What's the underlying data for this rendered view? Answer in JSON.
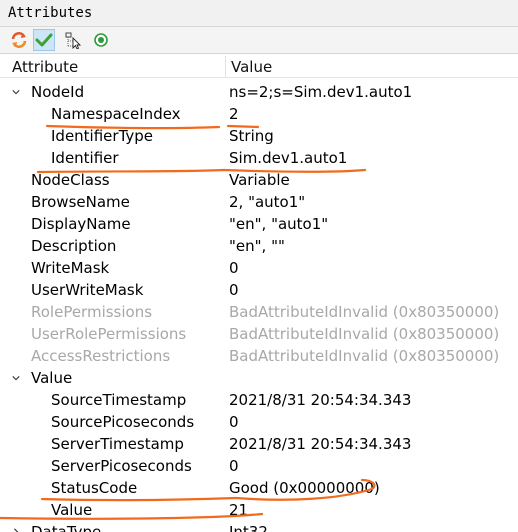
{
  "panel": {
    "title": "Attributes"
  },
  "toolbar": {
    "buttons": [
      {
        "icon": "refresh-icon"
      },
      {
        "icon": "check-icon",
        "active": true
      },
      {
        "icon": "tree-select-icon"
      },
      {
        "icon": "radio-target-icon"
      }
    ]
  },
  "columns": {
    "attribute": "Attribute",
    "value": "Value"
  },
  "rows": [
    {
      "name": "NodeId",
      "value": "ns=2;s=Sim.dev1.auto1",
      "level": 0,
      "expanded": true
    },
    {
      "name": "NamespaceIndex",
      "value": "2",
      "level": 1
    },
    {
      "name": "IdentifierType",
      "value": "String",
      "level": 1
    },
    {
      "name": "Identifier",
      "value": "Sim.dev1.auto1",
      "level": 1
    },
    {
      "name": "NodeClass",
      "value": "Variable",
      "level": 0
    },
    {
      "name": "BrowseName",
      "value": "2, \"auto1\"",
      "level": 0
    },
    {
      "name": "DisplayName",
      "value": "\"en\", \"auto1\"",
      "level": 0
    },
    {
      "name": "Description",
      "value": "\"en\", \"\"",
      "level": 0
    },
    {
      "name": "WriteMask",
      "value": "0",
      "level": 0
    },
    {
      "name": "UserWriteMask",
      "value": "0",
      "level": 0
    },
    {
      "name": "RolePermissions",
      "value": "BadAttributeIdInvalid (0x80350000)",
      "level": 0,
      "dim": true
    },
    {
      "name": "UserRolePermissions",
      "value": "BadAttributeIdInvalid (0x80350000)",
      "level": 0,
      "dim": true
    },
    {
      "name": "AccessRestrictions",
      "value": "BadAttributeIdInvalid (0x80350000)",
      "level": 0,
      "dim": true
    },
    {
      "name": "Value",
      "value": "",
      "level": 0,
      "expanded": true
    },
    {
      "name": "SourceTimestamp",
      "value": "2021/8/31 20:54:34.343",
      "level": 1
    },
    {
      "name": "SourcePicoseconds",
      "value": "0",
      "level": 1
    },
    {
      "name": "ServerTimestamp",
      "value": "2021/8/31 20:54:34.343",
      "level": 1
    },
    {
      "name": "ServerPicoseconds",
      "value": "0",
      "level": 1
    },
    {
      "name": "StatusCode",
      "value": "Good (0x00000000)",
      "level": 1
    },
    {
      "name": "Value",
      "value": "21",
      "level": 1
    },
    {
      "name": "DataType",
      "value": "Int32",
      "level": 0,
      "expanded": false
    }
  ],
  "colors": {
    "annotation": "#f26a1b",
    "dim_text": "#a8a8a8",
    "active_button": "#cde6f7"
  }
}
